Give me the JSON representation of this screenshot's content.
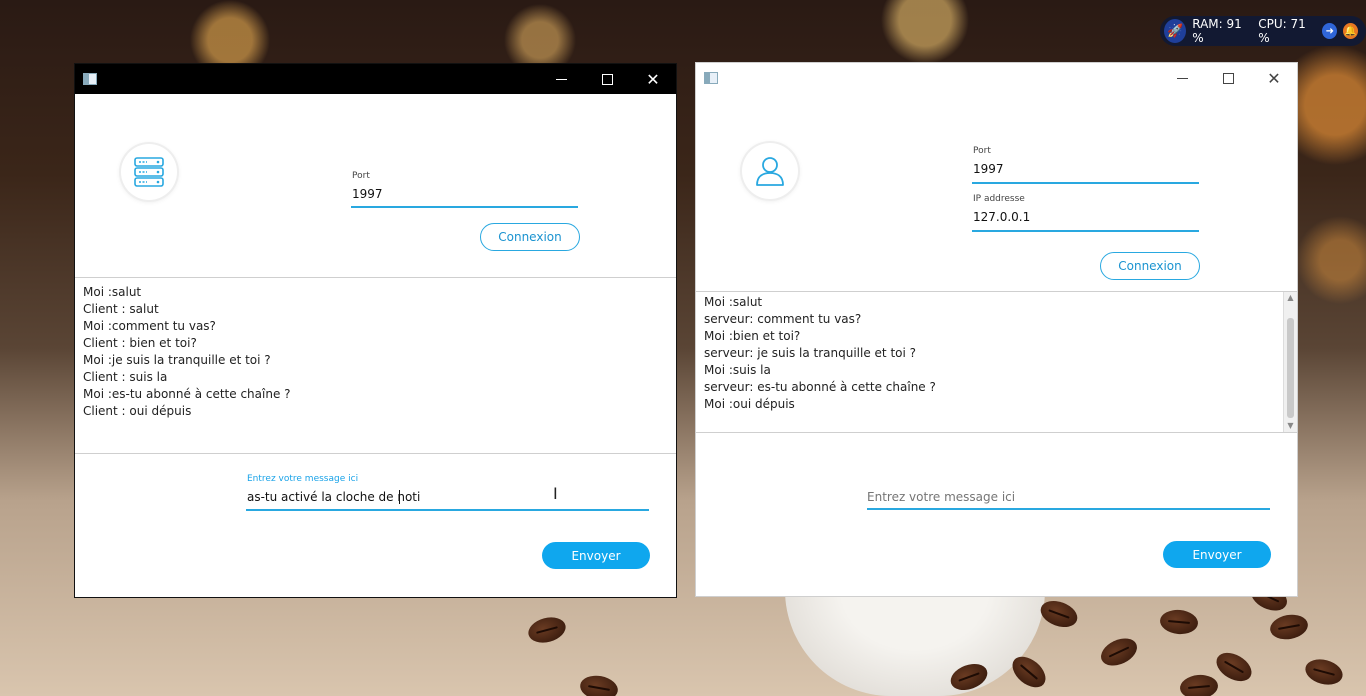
{
  "tray": {
    "ram": "RAM: 91 %",
    "cpu": "CPU: 71 %",
    "icons": [
      "rocket-icon",
      "arrow-right-icon",
      "bell-icon"
    ]
  },
  "server_window": {
    "port_label": "Port",
    "port_value": "1997",
    "connect_label": "Connexion",
    "messages": [
      "Moi :salut",
      "Client : salut",
      "Moi :comment tu vas?",
      "Client : bien et toi?",
      "Moi :je suis la tranquille et toi ?",
      "Client : suis la",
      "Moi :es-tu abonné à cette chaîne ?",
      "Client : oui dépuis"
    ],
    "input_label": "Entrez votre message ici",
    "input_value": "as-tu activé la cloche de noti",
    "send_label": "Envoyer"
  },
  "client_window": {
    "port_label": "Port",
    "port_value": "1997",
    "ip_label": "IP addresse",
    "ip_value": "127.0.0.1",
    "connect_label": "Connexion",
    "messages": [
      "Moi :salut",
      "serveur: comment tu vas?",
      "Moi :bien et toi?",
      "serveur: je suis la tranquille et toi ?",
      "Moi :suis la",
      "serveur: es-tu abonné à cette chaîne ?",
      "Moi :oui dépuis"
    ],
    "input_placeholder": "Entrez votre message ici",
    "send_label": "Envoyer"
  },
  "colors": {
    "accent": "#29a8e0",
    "send_button": "#0fa7ee"
  }
}
